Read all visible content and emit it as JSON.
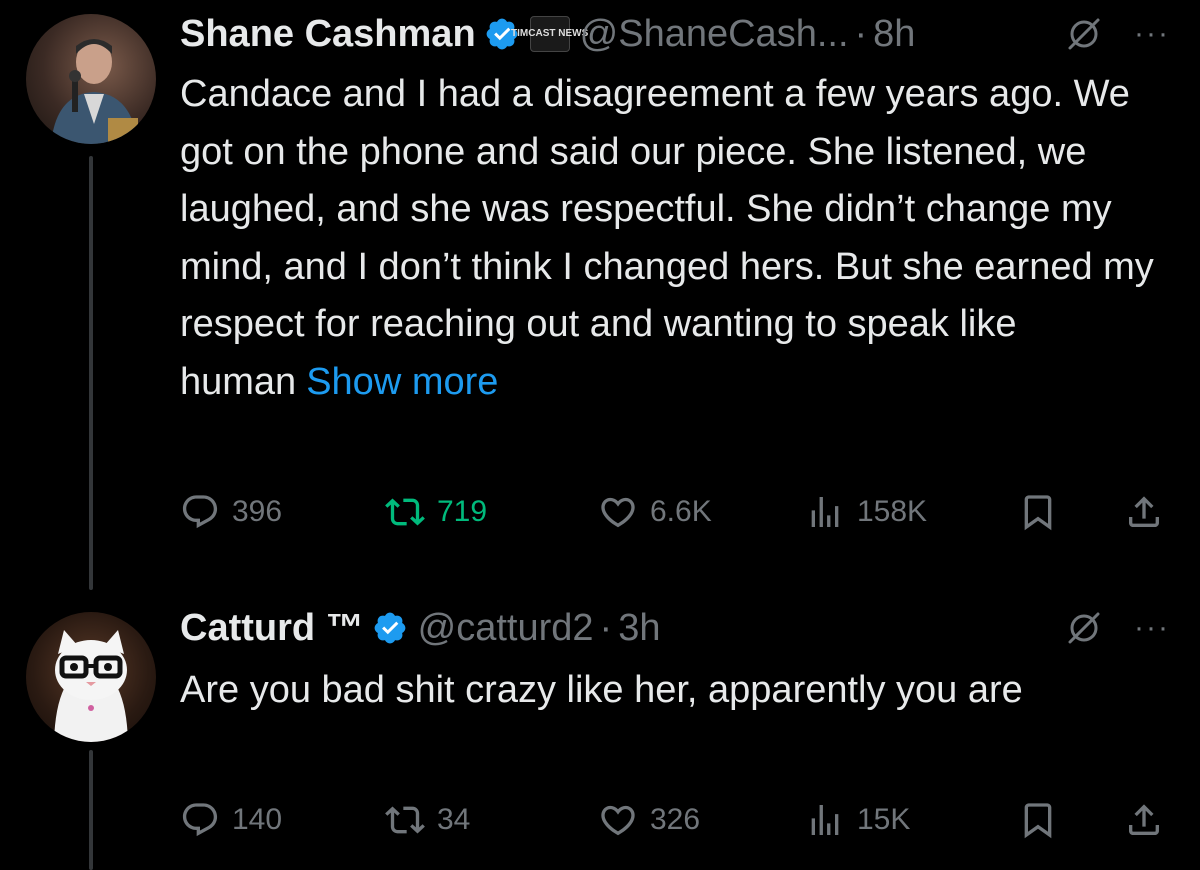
{
  "tweets": [
    {
      "author_name": "Shane Cashman",
      "affiliation_badge": "TIMCAST NEWS",
      "handle": "@ShaneCash...",
      "separator": "·",
      "time": "8h",
      "text": "Candace and I had a disagreement a few years ago. We got on the phone and said our piece. She listened, we laughed, and she was respectful. She didn’t change my mind, and I don’t think I changed hers. But she earned my respect for reaching out and wanting to speak like human",
      "show_more": "Show more",
      "replies": "396",
      "reposts": "719",
      "likes": "6.6K",
      "views": "158K",
      "reposted_by_viewer": true
    },
    {
      "author_name": "Catturd ™",
      "handle": "@catturd2",
      "separator": "·",
      "time": "3h",
      "text": "Are you bad shit crazy like her, apparently you are",
      "replies": "140",
      "reposts": "34",
      "likes": "326",
      "views": "15K",
      "reposted_by_viewer": false
    }
  ],
  "icons": {
    "verified": "verified-badge-icon",
    "grok": "grok-icon",
    "more": "more-icon",
    "reply": "reply-icon",
    "repost": "repost-icon",
    "like": "like-icon",
    "views": "views-icon",
    "bookmark": "bookmark-icon",
    "share": "share-icon"
  },
  "colors": {
    "background": "#000000",
    "text": "#e7e9ea",
    "muted": "#71767b",
    "link": "#1d9bf0",
    "verified": "#1d9bf0",
    "reposted": "#00ba7c"
  },
  "more_glyph": "···"
}
